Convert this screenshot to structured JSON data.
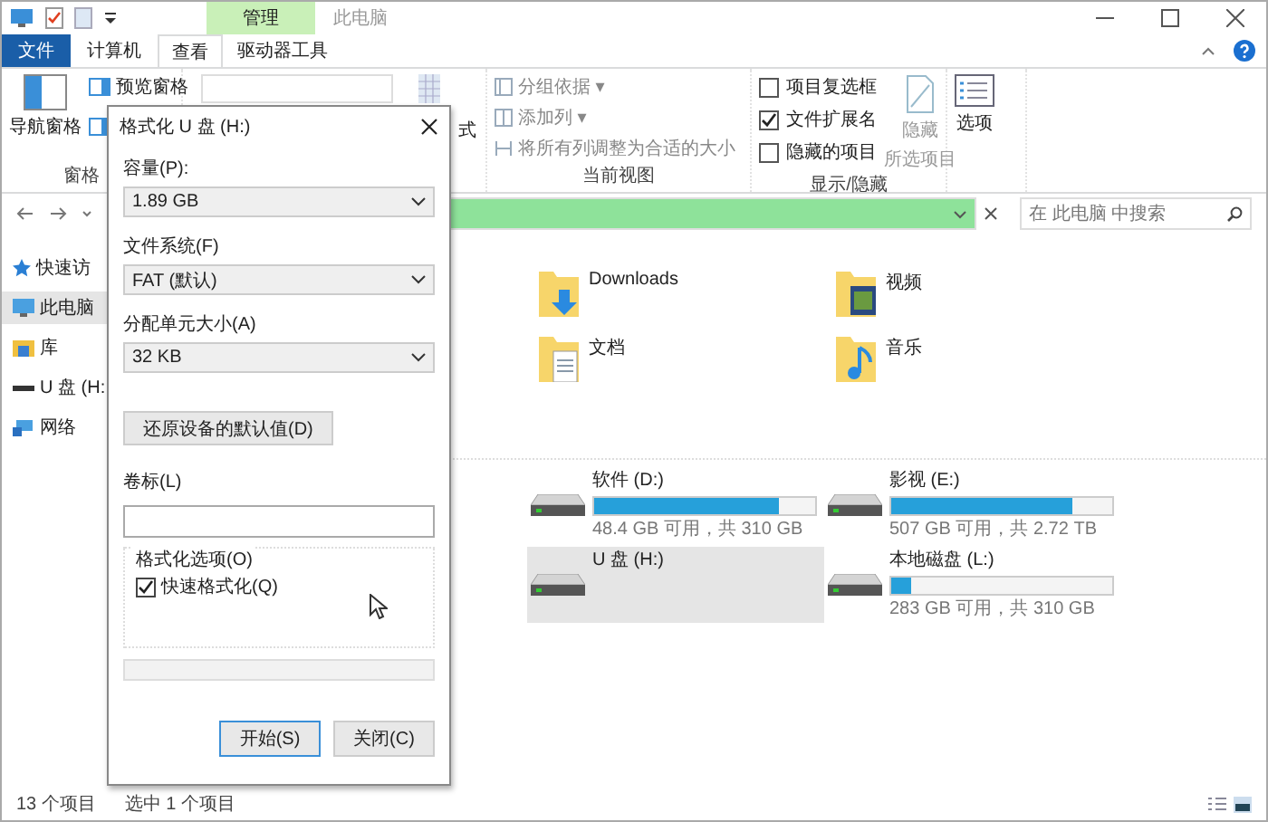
{
  "window": {
    "title": "此电脑",
    "context_tab": "管理"
  },
  "ribbon_tabs": [
    {
      "label": "文件",
      "kind": "file",
      "selected": false
    },
    {
      "label": "计算机",
      "kind": "tab",
      "selected": false
    },
    {
      "label": "查看",
      "kind": "tab",
      "selected": true
    },
    {
      "label": "驱动器工具",
      "kind": "context",
      "selected": false
    }
  ],
  "ribbon": {
    "panes": {
      "navigation_pane": "导航窗格",
      "preview_pane": "预览窗格",
      "group_label": "窗格"
    },
    "layout": {
      "label_fragment": "式"
    },
    "current_view": {
      "group_by": "分组依据 ▾",
      "add_columns": "添加列 ▾",
      "size_columns": "将所有列调整为合适的大小",
      "group_label": "当前视图"
    },
    "show_hide": {
      "checkboxes": [
        {
          "label": "项目复选框",
          "checked": false
        },
        {
          "label": "文件扩展名",
          "checked": true
        },
        {
          "label": "隐藏的项目",
          "checked": false
        }
      ],
      "hide_selected": {
        "label_lines": [
          "隐藏",
          "所选项目"
        ],
        "disabled": true
      },
      "options": "选项",
      "group_label": "显示/隐藏"
    }
  },
  "address_bar": {
    "level": 1
  },
  "search": {
    "placeholder": "在 此电脑 中搜索"
  },
  "sidebar": {
    "items": [
      {
        "label": "快速访",
        "kind": "star",
        "selected": false
      },
      {
        "label": "此电脑",
        "kind": "computer",
        "selected": true
      },
      {
        "label": "库",
        "kind": "library",
        "selected": false
      },
      {
        "label": "U 盘 (H:",
        "kind": "usb",
        "selected": false
      },
      {
        "label": "网络",
        "kind": "network",
        "selected": false
      }
    ]
  },
  "folders": [
    {
      "name": "Downloads",
      "kind": "download"
    },
    {
      "name": "视频",
      "kind": "video"
    },
    {
      "name": "文档",
      "kind": "document"
    },
    {
      "name": "音乐",
      "kind": "music"
    }
  ],
  "drives": [
    {
      "name": "软件 (D:)",
      "free": "48.4 GB 可用，共 310 GB",
      "level": 0.84,
      "selected": false
    },
    {
      "name": "影视 (E:)",
      "free": "507 GB 可用，共 2.72 TB",
      "level": 0.82,
      "selected": false
    },
    {
      "name": "U 盘 (H:)",
      "selected": true
    },
    {
      "name": "本地磁盘 (L:)",
      "free": "283 GB 可用，共 310 GB",
      "level": 0.09,
      "selected": false
    }
  ],
  "status_bar": {
    "count": "13 个项目",
    "selection": "选中 1 个项目"
  },
  "dialog": {
    "title": "格式化 U 盘 (H:)",
    "capacity": {
      "label": "容量(P):",
      "value": "1.89 GB"
    },
    "file_system": {
      "label": "文件系统(F)",
      "value": "FAT (默认)"
    },
    "allocation": {
      "label": "分配单元大小(A)",
      "value": "32 KB"
    },
    "restore_button": "还原设备的默认值(D)",
    "volume_label": {
      "label": "卷标(L)"
    },
    "format_options": {
      "label": "格式化选项(O)",
      "quick_format": {
        "label": "快速格式化(Q)",
        "checked": true
      }
    },
    "progress": {
      "level": 0
    },
    "buttons": [
      {
        "label": "开始(S)",
        "default": true
      },
      {
        "label": "关闭(C)",
        "default": false
      }
    ]
  }
}
